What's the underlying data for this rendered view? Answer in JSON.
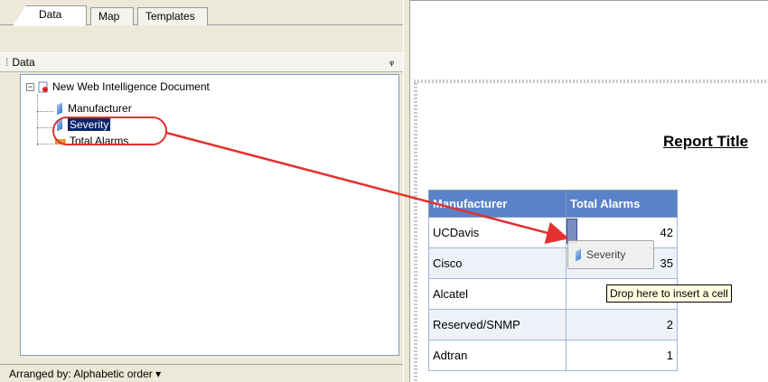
{
  "tabs": [
    {
      "label": "Data",
      "active": true
    },
    {
      "label": "Map",
      "active": false
    },
    {
      "label": "Templates",
      "active": false
    }
  ],
  "data_panel": {
    "title": "Data",
    "pin_icon": "pin-icon"
  },
  "tree": {
    "root": "New Web Intelligence Document",
    "items": [
      {
        "label": "Manufacturer",
        "icon": "dimension-icon"
      },
      {
        "label": "Severity",
        "icon": "dimension-icon",
        "selected": true
      },
      {
        "label": "Total Alarms",
        "icon": "measure-icon"
      }
    ]
  },
  "footer": {
    "label": "Arranged by: Alphabetic order ▾"
  },
  "report": {
    "title": "Report Title",
    "columns": [
      "Manufacturer",
      "Total Alarms"
    ],
    "rows": [
      {
        "manufacturer": "UCDavis",
        "total": "42"
      },
      {
        "manufacturer": "Cisco",
        "total": "35"
      },
      {
        "manufacturer": "Alcatel",
        "total": ""
      },
      {
        "manufacturer": "Reserved/SNMP",
        "total": "2"
      },
      {
        "manufacturer": "Adtran",
        "total": "1"
      }
    ]
  },
  "drag": {
    "chip_label": "Severity",
    "tooltip": "Drop here to insert a cell"
  },
  "colors": {
    "annotation": "#e53030",
    "table_header": "#5a82c8",
    "selection": "#0a246a"
  }
}
